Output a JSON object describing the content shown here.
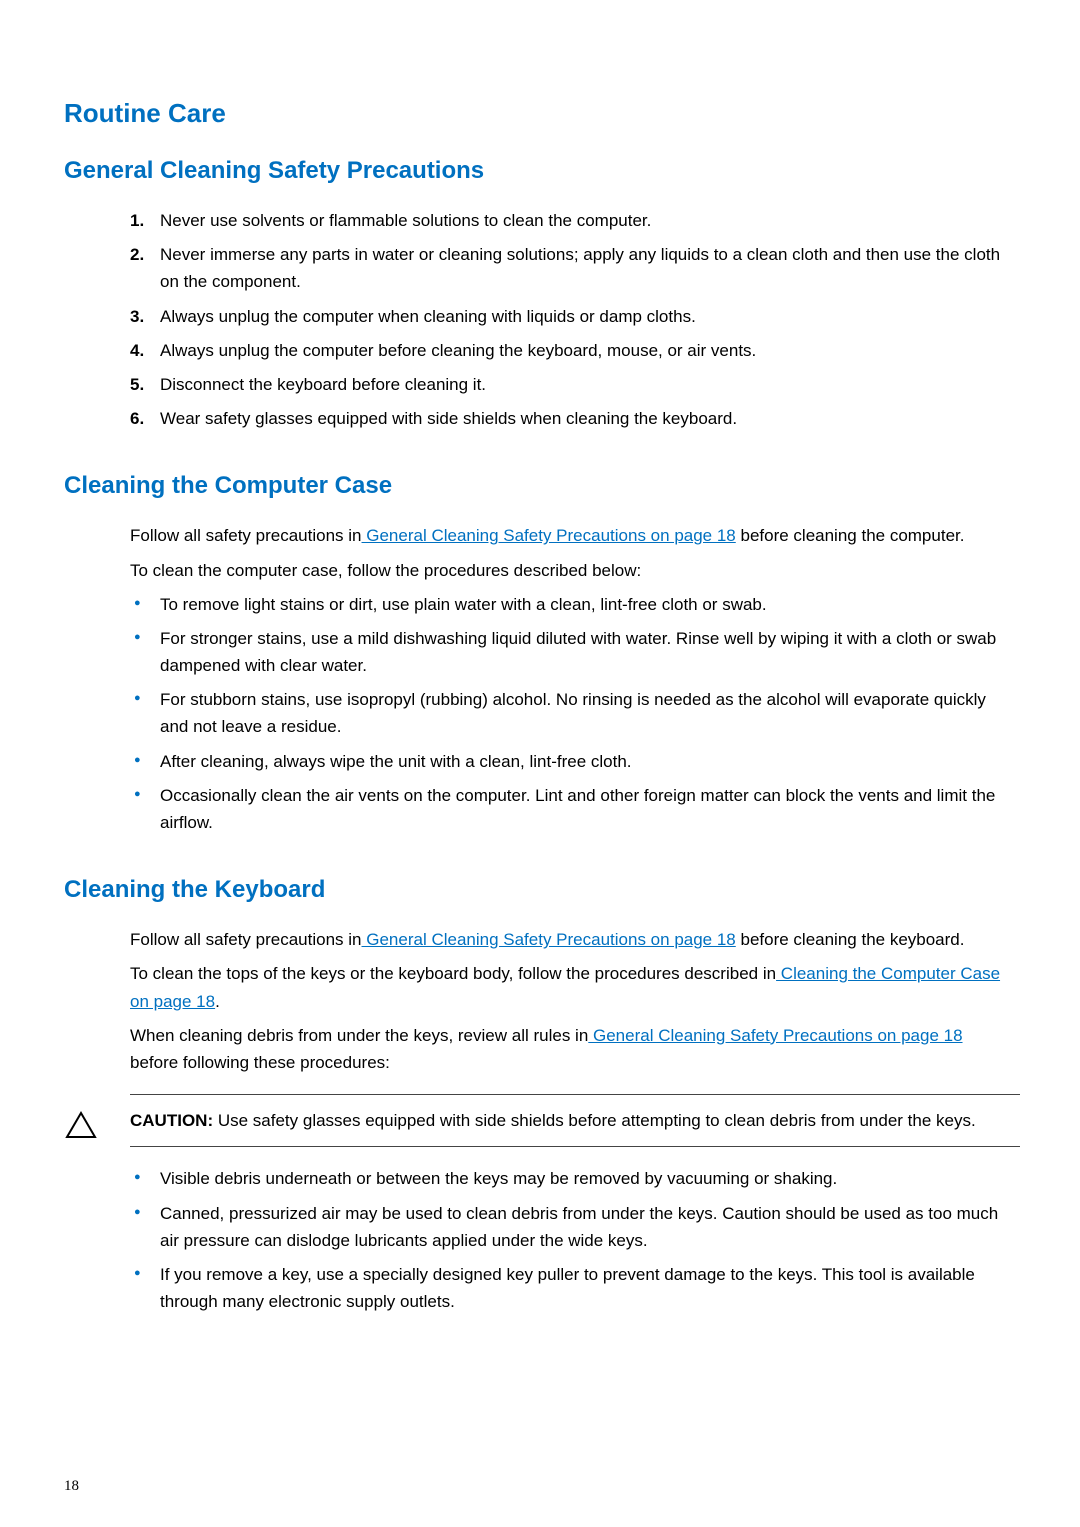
{
  "title": "Routine Care",
  "section1": {
    "heading": "General Cleaning Safety Precautions",
    "items": [
      "Never use solvents or flammable solutions to clean the computer.",
      "Never immerse any parts in water or cleaning solutions; apply any liquids to a clean cloth and then use the cloth on the component.",
      "Always unplug the computer when cleaning with liquids or damp cloths.",
      "Always unplug the computer before cleaning the keyboard, mouse, or air vents.",
      "Disconnect the keyboard before cleaning it.",
      " Wear safety glasses equipped with side shields when cleaning the keyboard."
    ]
  },
  "section2": {
    "heading": "Cleaning the Computer Case",
    "intro_before_link": "Follow all safety precautions in",
    "intro_link": " General Cleaning Safety Precautions on page 18",
    "intro_after_link": " before cleaning the computer.",
    "procedures_intro": "To clean the computer case, follow the procedures described below:",
    "bullets": [
      "To remove light stains or dirt, use plain water with a clean, lint-free cloth or swab.",
      "For stronger stains, use a mild dishwashing liquid diluted with water. Rinse well by wiping it with a cloth or swab dampened with clear water.",
      "For stubborn stains, use isopropyl (rubbing) alcohol. No rinsing is needed as the alcohol will evaporate quickly and not leave a residue.",
      "After cleaning, always wipe the unit with a clean, lint-free cloth.",
      "Occasionally clean the air vents on the computer. Lint and other foreign matter can block the vents and limit the airflow."
    ]
  },
  "section3": {
    "heading": "Cleaning the Keyboard",
    "p1_before": "Follow all safety precautions in",
    "p1_link": " General Cleaning Safety Precautions on page 18",
    "p1_after": " before cleaning the keyboard.",
    "p2_before": "To clean the tops of the keys or the keyboard body, follow the procedures described in",
    "p2_link": " Cleaning the Computer Case on page 18",
    "p2_after": ".",
    "p3_before": "When cleaning debris from under the keys, review all rules in",
    "p3_link": " General Cleaning Safety Precautions on page 18",
    "p3_after": " before following these procedures:",
    "caution_label": "CAUTION:",
    "caution_text": " Use safety glasses equipped with side shields before attempting to clean debris from under the keys.",
    "bullets": [
      " Visible debris underneath or between the keys may be removed by vacuuming or shaking.",
      " Canned, pressurized air may be used to clean debris from under the keys. Caution should be used as too much air pressure can dislodge lubricants applied under the wide keys.",
      " If you remove a key, use a specially designed key puller to prevent damage to the keys. This tool is available through many electronic supply outlets."
    ]
  },
  "page_number": "18"
}
